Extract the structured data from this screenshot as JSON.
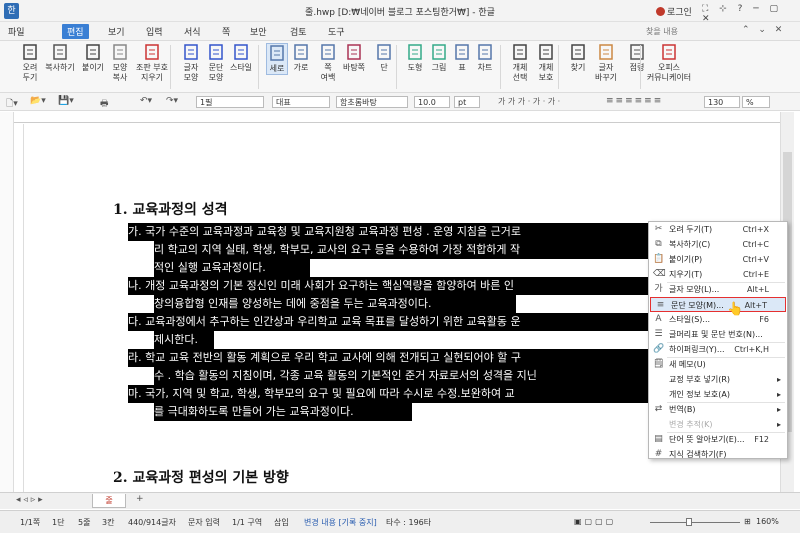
{
  "window": {
    "app_icon": "한",
    "title": "줄.hwp [D:₩네이버 블로그 포스팅한거₩] - 한글",
    "login": "로그인",
    "controls": "⛶ ⊹ ? ─ ▢ ✕"
  },
  "menu": {
    "items": [
      "파일",
      "편집",
      "보기",
      "입력",
      "서식",
      "쪽",
      "보안",
      "검토",
      "도구"
    ],
    "active": "편집",
    "search_placeholder": "찾을 내용",
    "right": "⌃ ⌄ ✕"
  },
  "ribbon": [
    {
      "label": "오려\n두기",
      "icon": "scissors-icon"
    },
    {
      "label": "복사하기",
      "icon": "copy-icon"
    },
    {
      "label": "붙이기",
      "icon": "paste-icon"
    },
    {
      "label": "모양\n복사",
      "icon": "format-painter-icon"
    },
    {
      "label": "조판 부호\n지우기",
      "icon": "clear-marks-icon"
    },
    {
      "label": "글자\n모양",
      "icon": "char-shape-icon"
    },
    {
      "label": "문단\n모양",
      "icon": "para-shape-icon"
    },
    {
      "label": "스타일",
      "icon": "style-icon"
    },
    {
      "label": "세로",
      "icon": "portrait-icon"
    },
    {
      "label": "가로",
      "icon": "landscape-icon"
    },
    {
      "label": "쪽\n여백",
      "icon": "margin-icon"
    },
    {
      "label": "바탕쪽",
      "icon": "master-page-icon"
    },
    {
      "label": "단",
      "icon": "columns-icon"
    },
    {
      "label": "도형",
      "icon": "shape-icon"
    },
    {
      "label": "그림",
      "icon": "picture-icon"
    },
    {
      "label": "표",
      "icon": "table-icon"
    },
    {
      "label": "차트",
      "icon": "chart-icon"
    },
    {
      "label": "개체\n선택",
      "icon": "select-object-icon"
    },
    {
      "label": "개체\n보호",
      "icon": "protect-object-icon"
    },
    {
      "label": "찾기",
      "icon": "find-icon"
    },
    {
      "label": "글자\n바꾸기",
      "icon": "replace-icon"
    },
    {
      "label": "점령",
      "icon": "goto-icon"
    },
    {
      "label": "오피스\n커뮤니케이터",
      "icon": "communicator-icon"
    }
  ],
  "toolbar2": {
    "style": "1필",
    "font_group": "대표",
    "font": "함초롬바탕",
    "size": "10.0",
    "unit": "pt",
    "char_buttons": "가 가 가 · 가 · 가 ·",
    "zoom": "130",
    "zoom_unit": "%"
  },
  "document": {
    "heading1": "1. 교육과정의 성격",
    "lines": [
      "가. 국가 수준의 교육과정과 교육청 및 교육지원청 교육과정 편성 . 운영 지침을 근거로",
      "리 학교의 지역 실태, 학생, 학부모, 교사의 요구 등을 수용하여 가장 적합하게 작",
      "적인 실행 교육과정이다.",
      "나. 개정 교육과정의 기본 정신인 미래 사회가 요구하는 핵심역량을 함양하여 바른 인",
      "창의융합형 인재를 양성하는 데에 중점을 두는 교육과정이다.",
      "다. 교육과정에서 추구하는 인간상과 우리학교 교육 목표를 달성하기 위한 교육활동 운",
      "제시한다.",
      "라. 학교 교육 전반의 활동 계획으로 우리 학교 교사에 의해 전개되고 실현되어야 할 구",
      "수 . 학습 활동의 지침이며, 각종 교육 활동의 기본적인 준거 자료로서의 성격을 지닌",
      "마. 국가, 지역 및 학교, 학생, 학부모의 요구 및 필요에 따라 수시로 수정.보완하여 교",
      "를 극대화하도록 만들어 가는 교육과정이다."
    ],
    "heading2": "2. 교육과정 편성의 기본 방향"
  },
  "context_menu": [
    {
      "label": "오려 두기(T)",
      "shortcut": "Ctrl+X",
      "icon": "scissors-icon"
    },
    {
      "label": "복사하기(C)",
      "shortcut": "Ctrl+C",
      "icon": "copy-icon"
    },
    {
      "label": "붙이기(P)",
      "shortcut": "Ctrl+V",
      "icon": "paste-icon"
    },
    {
      "label": "지우기(T)",
      "shortcut": "Ctrl+E",
      "icon": "erase-icon"
    },
    {
      "label": "글자 모양(L)...",
      "shortcut": "Alt+L",
      "icon": "char-shape-icon"
    },
    {
      "label": "문단 모양(M)...",
      "shortcut": "Alt+T",
      "icon": "para-shape-icon"
    },
    {
      "label": "스타일(S)...",
      "shortcut": "F6",
      "icon": "style-icon"
    },
    {
      "label": "글머리표 및 문단 번호(N)...",
      "shortcut": "",
      "icon": "bullets-icon"
    },
    {
      "label": "하이퍼링크(Y)...",
      "shortcut": "Ctrl+K,H",
      "icon": "hyperlink-icon"
    },
    {
      "label": "새 메모(U)",
      "shortcut": "",
      "icon": "memo-icon"
    },
    {
      "label": "교정 부호 넣기(R)",
      "shortcut": "",
      "icon": "",
      "submenu": "▸"
    },
    {
      "label": "개인 정보 보호(A)",
      "shortcut": "",
      "icon": "",
      "submenu": "▸"
    },
    {
      "label": "번역(B)",
      "shortcut": "",
      "icon": "translate-icon",
      "submenu": "▸"
    },
    {
      "label": "변경 추적(K)",
      "shortcut": "",
      "icon": "",
      "submenu": "▸"
    },
    {
      "label": "단어 뜻 알아보기(E)...",
      "shortcut": "F12",
      "icon": "dictionary-icon"
    },
    {
      "label": "지식 검색하기(F)",
      "shortcut": "",
      "icon": "hash-icon"
    }
  ],
  "tabs": {
    "doc_tab": "줄",
    "add": "+"
  },
  "status": {
    "page": "1/1쪽",
    "col": "1단",
    "line": "5줄",
    "pos": "3칸",
    "chars": "440/914글자",
    "mode": "문자 입력",
    "section": "1/1 구역",
    "insert": "삽입",
    "track": "변경 내용 [기록 중지]",
    "strokes": "타수 : 196타",
    "zoom": "160%"
  }
}
